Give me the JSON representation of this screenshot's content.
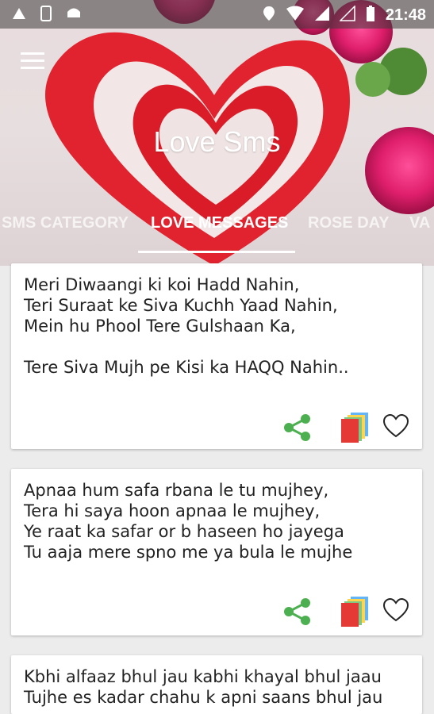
{
  "status_bar": {
    "time": "21:48"
  },
  "header": {
    "title": "Love Sms",
    "tabs": [
      {
        "label": "SMS CATEGORY",
        "active": false
      },
      {
        "label": "LOVE MESSAGES",
        "active": true
      },
      {
        "label": "ROSE DAY",
        "active": false
      },
      {
        "label": "VA",
        "active": false
      }
    ]
  },
  "messages": [
    {
      "text": "Meri Diwaangi ki koi Hadd Nahin,\nTeri Suraat ke Siva Kuchh Yaad Nahin,\nMein hu Phool Tere Gulshaan Ka,\n\nTere Siva Mujh pe Kisi ka HAQQ Nahin.."
    },
    {
      "text": "Apnaa hum safa rbana le tu mujhey,\nTera hi saya hoon apnaa le mujhey,\nYe raat ka safar or b haseen ho jayega\nTu aaja mere spno me ya bula le mujhe"
    },
    {
      "text": "Kbhi alfaaz bhul jau kabhi khayal bhul jaau\nTujhe es kadar chahu k apni saans bhul jau"
    }
  ],
  "colors": {
    "share": "#4caf50",
    "heart_red": "#e0232e",
    "copy_red": "#e53935"
  },
  "icons": [
    "menu-icon",
    "share-icon",
    "copy-icon",
    "heart-outline-icon"
  ]
}
